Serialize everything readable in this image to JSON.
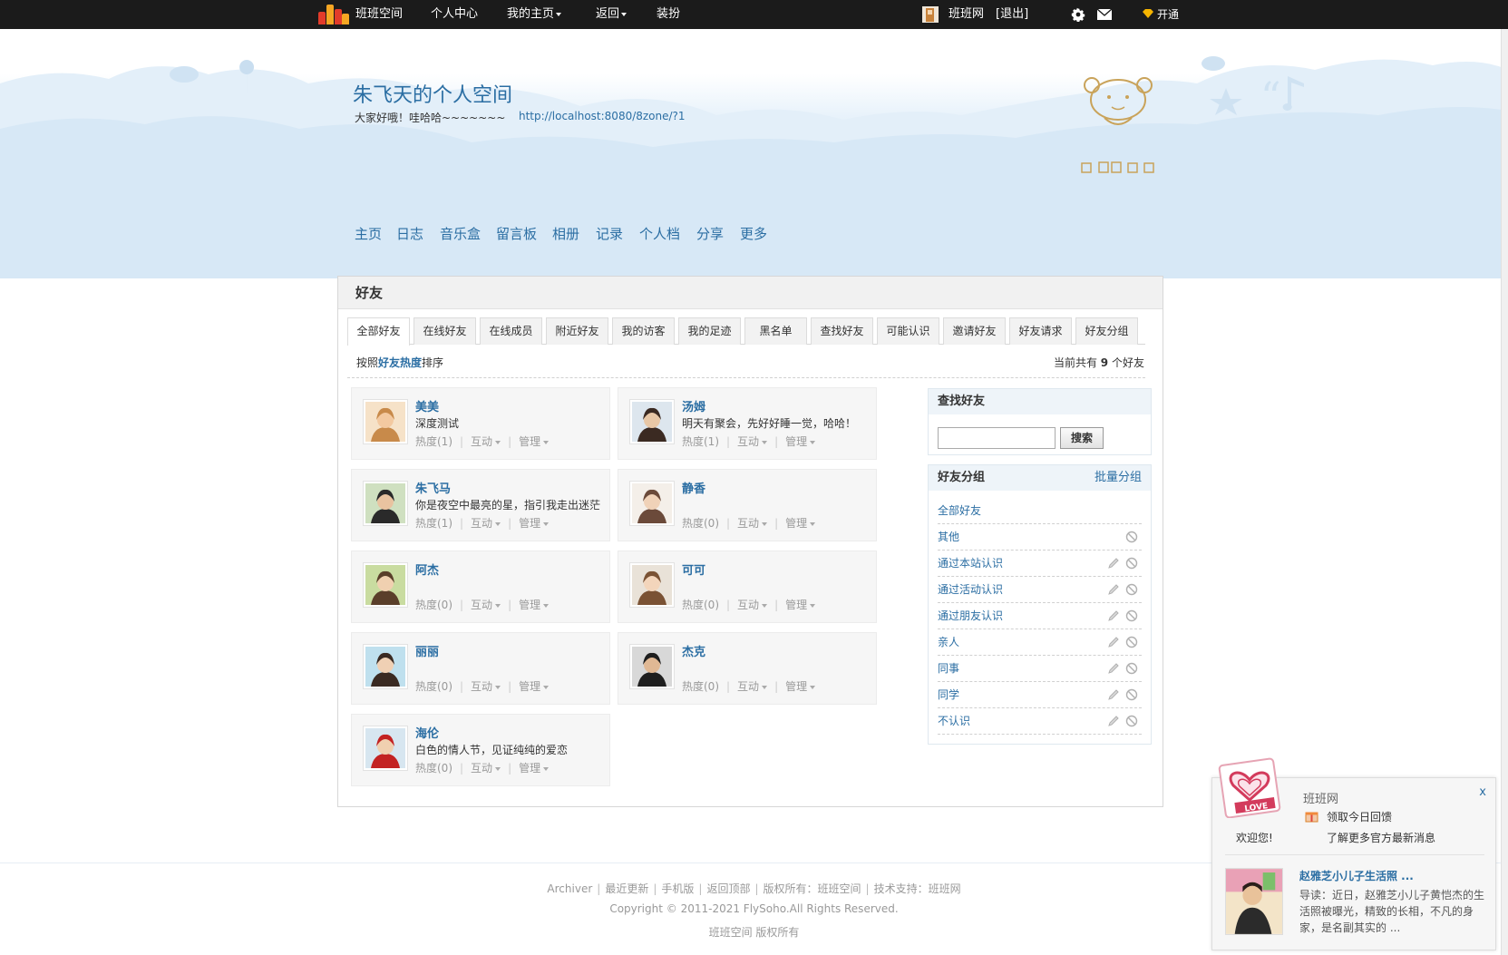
{
  "topbar": {
    "site_name": "班班空间",
    "personal_center": "个人中心",
    "my_home": "我的主页",
    "back": "返回",
    "dress_up": "装扮",
    "user_site": "班班网",
    "logout": "[退出]",
    "open": "开通"
  },
  "header": {
    "title": "朱飞天的个人空间",
    "motto": "大家好哦！哇哈哈~~~~~~~",
    "url": "http://localhost:8080/8zone/?1"
  },
  "nav": [
    "主页",
    "日志",
    "音乐盒",
    "留言板",
    "相册",
    "记录",
    "个人档",
    "分享",
    "更多"
  ],
  "panel": {
    "title": "好友",
    "tabs": [
      "全部好友",
      "在线好友",
      "在线成员",
      "附近好友",
      "我的访客",
      "我的足迹",
      "黑名单",
      "查找好友",
      "可能认识",
      "邀请好友",
      "好友请求",
      "好友分组"
    ],
    "active_tab": "全部好友",
    "sort_prefix": "按照",
    "sort_key": "好友热度",
    "sort_suffix": "排序",
    "count_prefix": "当前共有",
    "count": "9",
    "count_suffix": "个好友"
  },
  "friends": [
    {
      "name": "美美",
      "status": "深度测试",
      "heat": "热度(1)",
      "interact": "互动",
      "manage": "管理"
    },
    {
      "name": "汤姆",
      "status": "明天有聚会，先好好睡一觉，哈哈！",
      "heat": "热度(1)",
      "interact": "互动",
      "manage": "管理"
    },
    {
      "name": "朱飞马",
      "status": "你是夜空中最亮的星，指引我走出迷茫",
      "heat": "热度(1)",
      "interact": "互动",
      "manage": "管理"
    },
    {
      "name": "静香",
      "status": "",
      "heat": "热度(0)",
      "interact": "互动",
      "manage": "管理"
    },
    {
      "name": "阿杰",
      "status": "",
      "heat": "热度(0)",
      "interact": "互动",
      "manage": "管理"
    },
    {
      "name": "可可",
      "status": "",
      "heat": "热度(0)",
      "interact": "互动",
      "manage": "管理"
    },
    {
      "name": "丽丽",
      "status": "",
      "heat": "热度(0)",
      "interact": "互动",
      "manage": "管理"
    },
    {
      "name": "杰克",
      "status": "",
      "heat": "热度(0)",
      "interact": "互动",
      "manage": "管理"
    },
    {
      "name": "海伦",
      "status": "白色的情人节，见证纯纯的爱恋",
      "heat": "热度(0)",
      "interact": "互动",
      "manage": "管理"
    }
  ],
  "search_box": {
    "title": "查找好友",
    "value": "",
    "button": "搜索"
  },
  "groups_box": {
    "title": "好友分组",
    "batch": "批量分组",
    "groups": [
      "全部好友",
      "其他",
      "通过本站认识",
      "通过活动认识",
      "通过朋友认识",
      "亲人",
      "同事",
      "同学",
      "不认识"
    ]
  },
  "footer": {
    "links": [
      "Archiver",
      "最近更新",
      "手机版",
      "返回顶部",
      "版权所有：班班空间",
      "技术支持：班班网"
    ],
    "copyright": "Copyright © 2011-2021 FlySoho.All Rights Reserved.",
    "owner": "班班空间 版权所有"
  },
  "popup": {
    "title": "班班网",
    "close": "x",
    "gift": "领取今日回馈",
    "welcome": "欢迎您!",
    "more": "了解更多官方最新消息",
    "news_title": "赵雅芝小儿子生活照 ...",
    "news_text": "导读：近日，赵雅芝小儿子黄恺杰的生活照被曝光，精致的长相，不凡的身家，是名副其实的 ..."
  },
  "colors": {
    "link_blue": "#2b6ea3",
    "topbar_bg": "#1b1b1b",
    "open_gold": "#f5b400"
  }
}
